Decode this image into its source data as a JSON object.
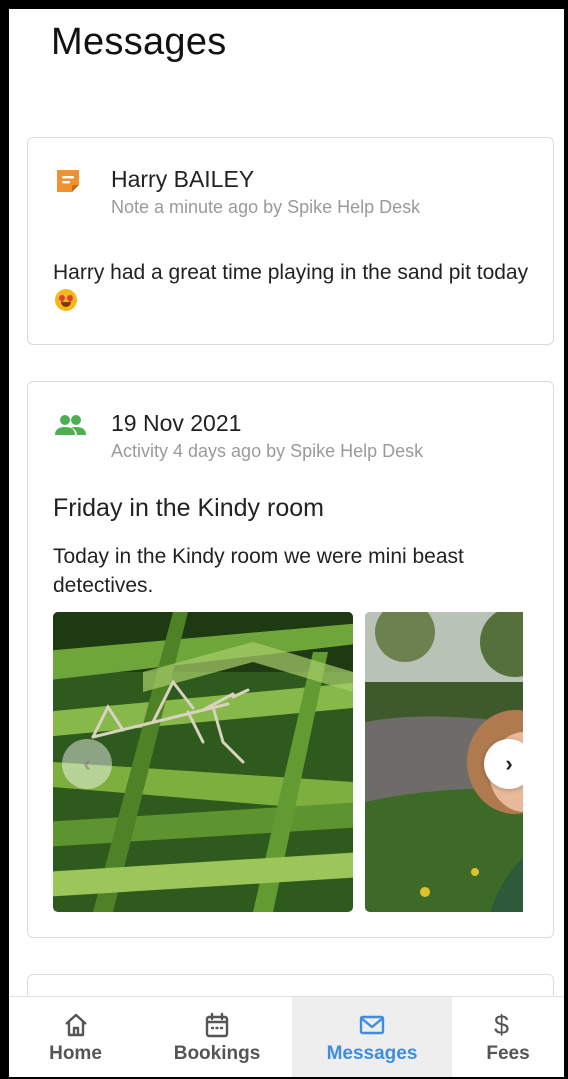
{
  "page": {
    "title": "Messages"
  },
  "note_card": {
    "icon": "note-icon",
    "title": "Harry BAILEY",
    "subtitle": "Note a minute ago by Spike Help Desk",
    "body": "Harry had a great time playing in the sand pit today"
  },
  "activity_card": {
    "icon": "group-icon",
    "title": "19 Nov 2021",
    "subtitle": "Activity 4 days ago by Spike Help Desk",
    "heading": "Friday in the Kindy room",
    "body": "Today in the Kindy room we were mini beast detectives.",
    "carousel": {
      "prev_label": "‹",
      "next_label": "›",
      "photos": [
        "praying-mantis-on-grass-photo",
        "child-in-garden-photo"
      ]
    }
  },
  "bottom_nav": {
    "items": [
      {
        "label": "Home",
        "icon": "home-icon",
        "active": false
      },
      {
        "label": "Bookings",
        "icon": "calendar-icon",
        "active": false
      },
      {
        "label": "Messages",
        "icon": "mail-icon",
        "active": true
      },
      {
        "label": "Fees",
        "icon": "dollar-icon",
        "active": false
      }
    ]
  },
  "colors": {
    "accent": "#3f8de0",
    "note_icon": "#f0922e",
    "activity_icon": "#4caf50",
    "subtitle_text": "#9a9a9a"
  }
}
